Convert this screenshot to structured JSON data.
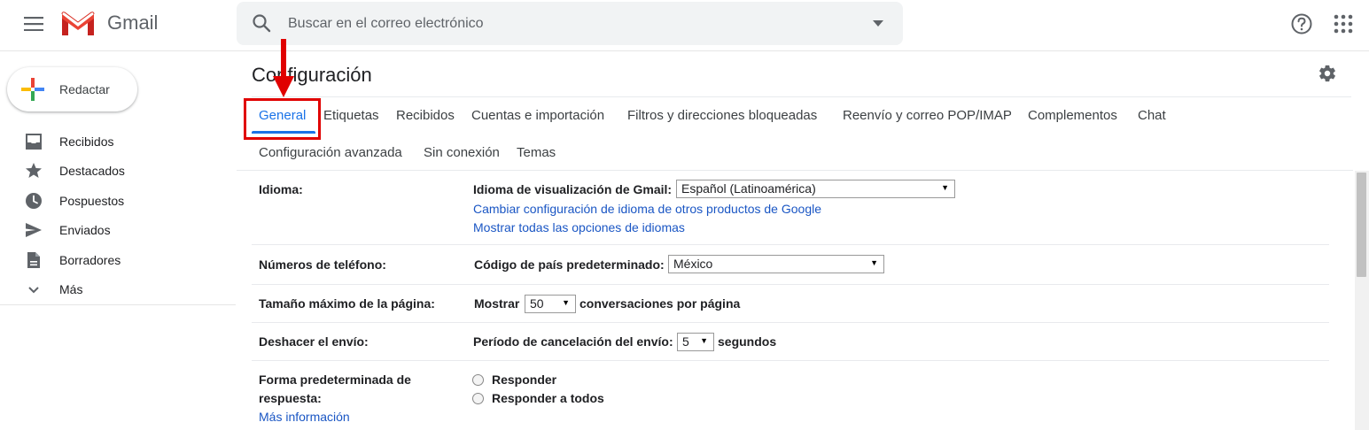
{
  "header": {
    "brand": "Gmail",
    "search_placeholder": "Buscar en el correo electrónico"
  },
  "sidebar": {
    "compose_label": "Redactar",
    "items": [
      {
        "label": "Recibidos",
        "icon": "inbox-icon"
      },
      {
        "label": "Destacados",
        "icon": "star-icon"
      },
      {
        "label": "Pospuestos",
        "icon": "clock-icon"
      },
      {
        "label": "Enviados",
        "icon": "send-icon"
      },
      {
        "label": "Borradores",
        "icon": "draft-icon"
      },
      {
        "label": "Más",
        "icon": "chevron-down-icon"
      }
    ]
  },
  "settings": {
    "title": "Configuración",
    "tabs": [
      "General",
      "Etiquetas",
      "Recibidos",
      "Cuentas e importación",
      "Filtros y direcciones bloqueadas",
      "Reenvío y correo POP/IMAP",
      "Complementos",
      "Chat",
      "Configuración avanzada",
      "Sin conexión",
      "Temas"
    ],
    "active_tab": "General",
    "rows": {
      "language": {
        "label": "Idioma:",
        "display_label": "Idioma de visualización de Gmail:",
        "display_value": "Español (Latinoamérica)",
        "link1": "Cambiar configuración de idioma de otros productos de Google",
        "link2": "Mostrar todas las opciones de idiomas"
      },
      "phone": {
        "label": "Números de teléfono:",
        "country_label": "Código de país predeterminado:",
        "country_value": "México"
      },
      "page_size": {
        "label": "Tamaño máximo de la página:",
        "prefix": "Mostrar",
        "value": "50",
        "suffix": "conversaciones por página"
      },
      "undo_send": {
        "label": "Deshacer el envío:",
        "prefix": "Período de cancelación del envío:",
        "value": "5",
        "suffix": "segundos"
      },
      "reply": {
        "label_line1": "Forma predeterminada de",
        "label_line2": "respuesta:",
        "link": "Más información",
        "option1": "Responder",
        "option2": "Responder a todos"
      }
    }
  },
  "colors": {
    "accent": "#1a73e8",
    "link": "#1a56c4",
    "annotation": "#e00000"
  }
}
